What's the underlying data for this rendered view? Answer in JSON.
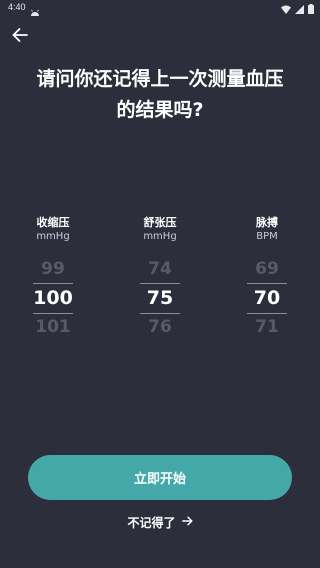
{
  "status_bar": {
    "time": "4:40",
    "icons": [
      "android-app-icon",
      "wifi-icon",
      "signal-icon",
      "battery-icon"
    ]
  },
  "header": {
    "back_icon": "arrow-left-icon"
  },
  "question": {
    "line1": "请问你还记得上一次测量血压",
    "line2": "的结果吗?"
  },
  "pickers": {
    "systolic": {
      "label": "收缩压",
      "unit": "mmHg",
      "prev": "99",
      "selected": "100",
      "next": "101"
    },
    "diastolic": {
      "label": "舒张压",
      "unit": "mmHg",
      "prev": "74",
      "selected": "75",
      "next": "76"
    },
    "pulse": {
      "label": "脉搏",
      "unit": "BPM",
      "prev": "69",
      "selected": "70",
      "next": "71"
    }
  },
  "actions": {
    "start_label": "立即开始",
    "forgot_label": "不记得了",
    "forgot_icon": "arrow-right-icon"
  },
  "colors": {
    "background": "#2c2f3b",
    "accent": "#44a8a8",
    "muted_value": "#575b68"
  }
}
